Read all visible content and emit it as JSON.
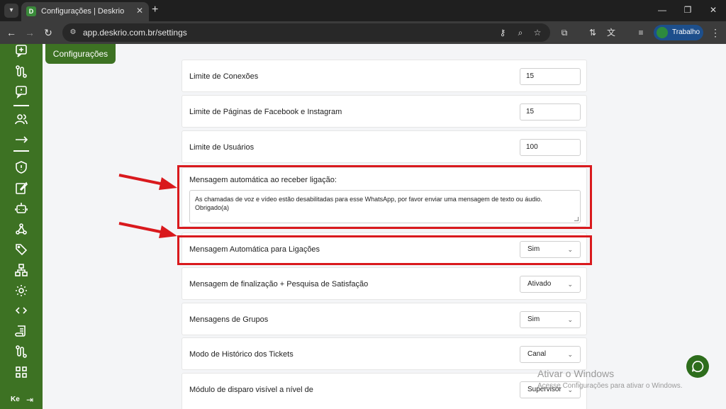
{
  "browser": {
    "tab_title": "Configurações | Deskrio",
    "tab_close": "✕",
    "new_tab": "+",
    "url": "app.deskrio.com.br/settings",
    "profile_name": "Trabalho",
    "window_buttons": [
      "—",
      "❐",
      "✕"
    ]
  },
  "sidebar": {
    "icons": [
      "add-message-icon",
      "route-icon",
      "chat-icon",
      "users-icon",
      "arrow-right-icon",
      "shield-icon",
      "edit-icon",
      "bot-icon",
      "webhook-icon",
      "tags-icon",
      "hierarchy-icon",
      "settings-icon",
      "code-icon",
      "scroll-icon",
      "route-icon",
      "grid-icon"
    ],
    "user_initials": "Ke",
    "logout": "⇥"
  },
  "page": {
    "tab_label": "Configurações",
    "rows": [
      {
        "label": "Limite de Conexões",
        "value": "15"
      },
      {
        "label": "Limite de Páginas de Facebook e Instagram",
        "value": "15"
      },
      {
        "label": "Limite de Usuários",
        "value": "100"
      }
    ],
    "auto_message": {
      "label": "Mensagem automática ao receber ligação:",
      "text": "As chamadas de voz e vídeo estão desabilitadas para esse WhatsApp, por favor enviar uma mensagem de texto ou áudio. Obrigado(a)"
    },
    "selects": [
      {
        "label": "Mensagem Automática para Ligações",
        "value": "Sim"
      },
      {
        "label": "Mensagem de finalização + Pesquisa de Satisfação",
        "value": "Ativado"
      },
      {
        "label": "Mensagens de Grupos",
        "value": "Sim"
      },
      {
        "label": "Modo de Histórico dos Tickets",
        "value": "Canal"
      },
      {
        "label": "Módulo de disparo visível a nível de",
        "value": "Supervisor"
      }
    ]
  },
  "watermark": {
    "title": "Ativar o Windows",
    "subtitle": "Acesse Configurações para ativar o Windows."
  },
  "colors": {
    "sidebar": "#3d7223",
    "highlight": "#d9191d"
  }
}
